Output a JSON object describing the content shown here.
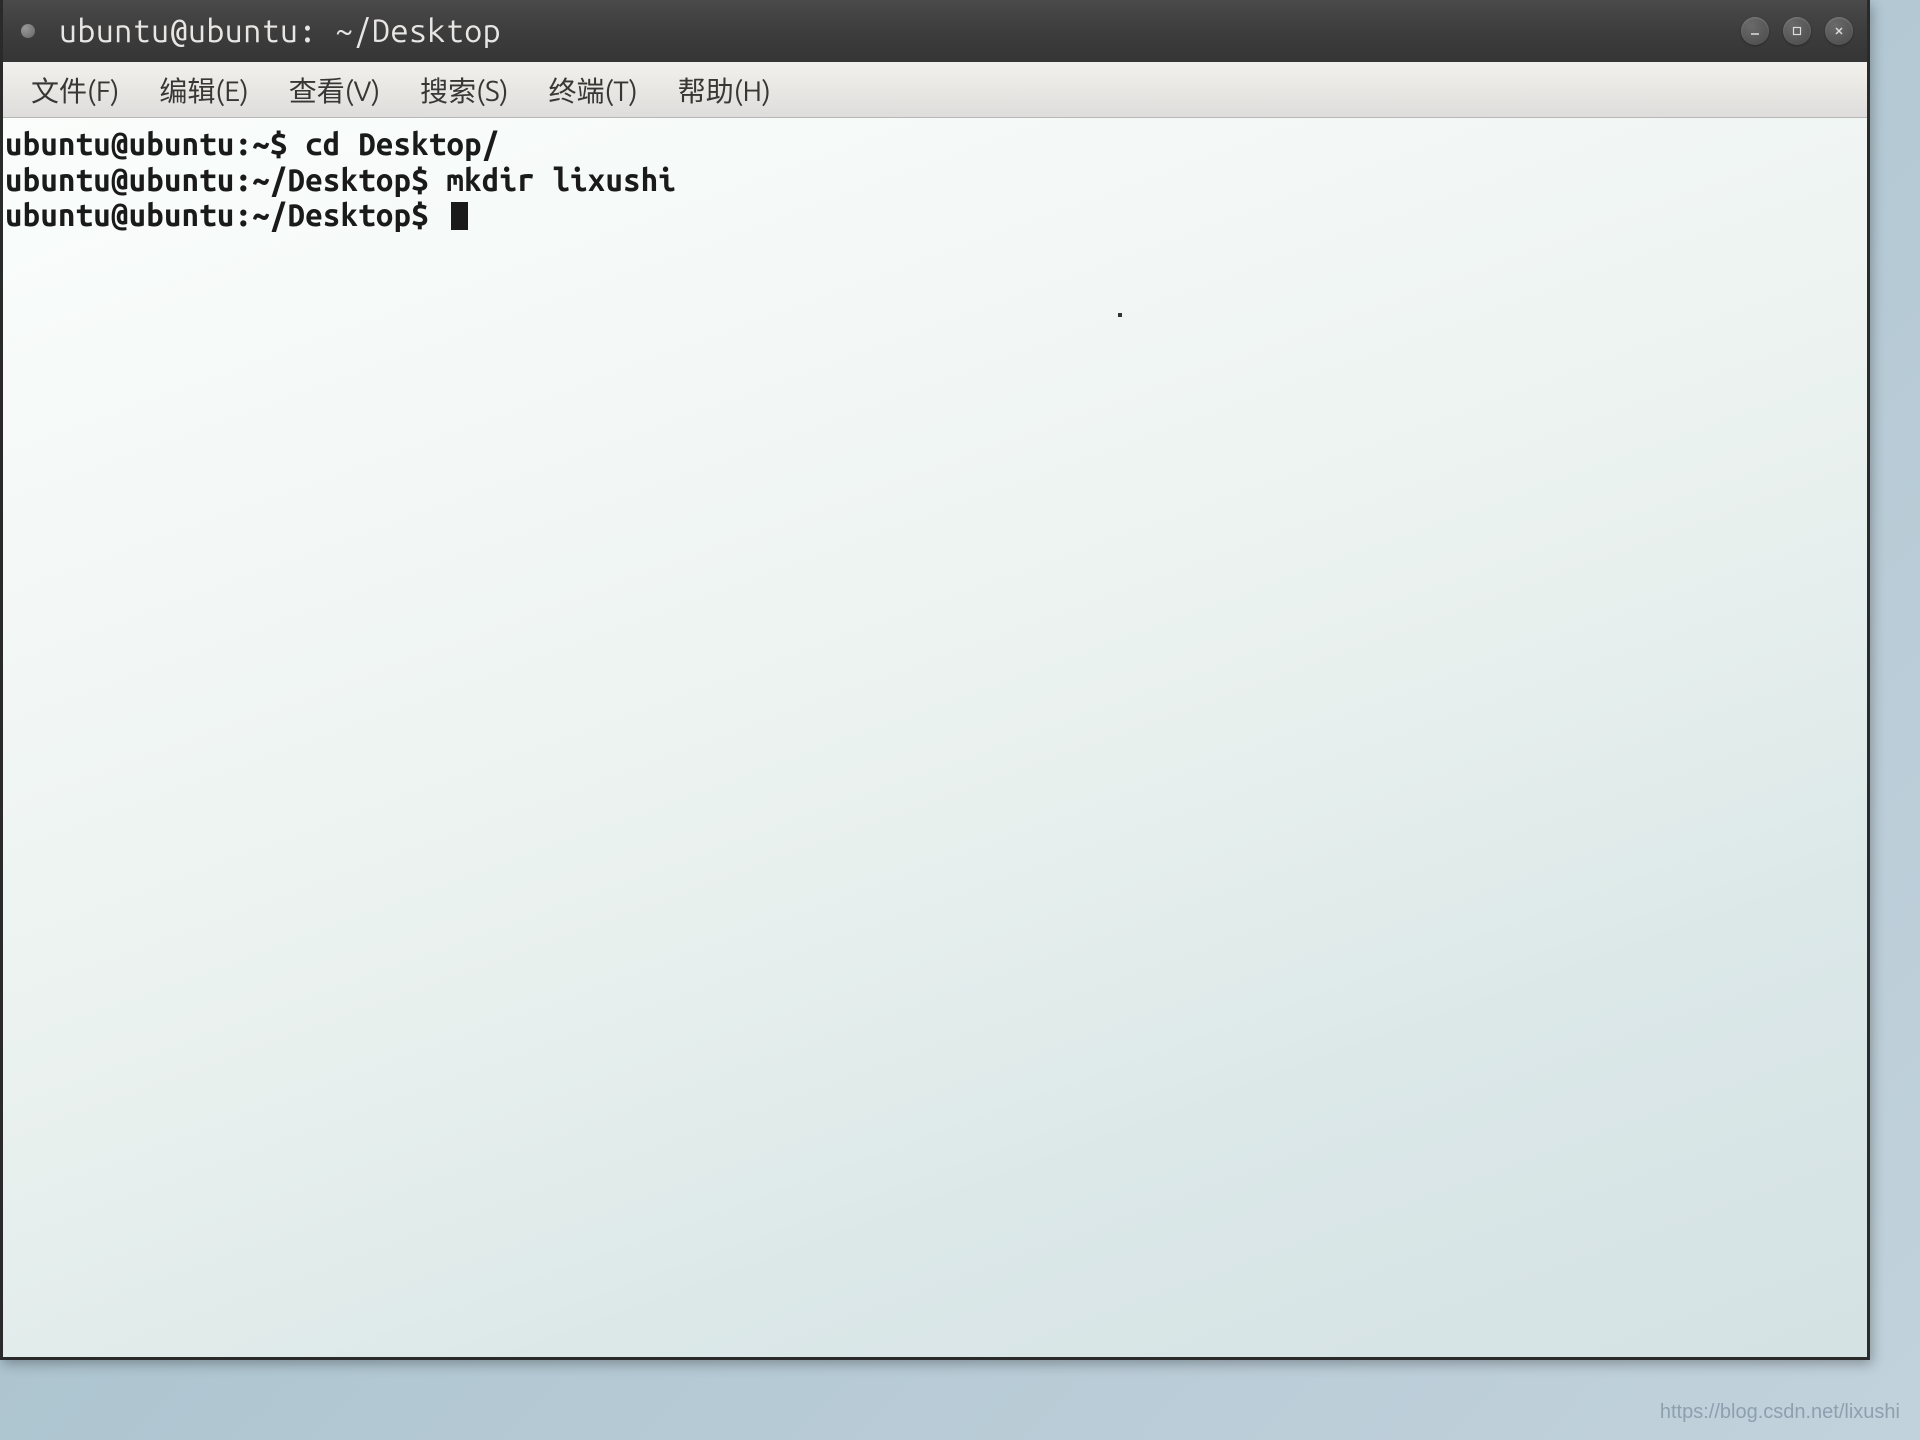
{
  "window": {
    "title": "ubuntu@ubuntu: ~/Desktop"
  },
  "menu": {
    "file": "文件(F)",
    "edit": "编辑(E)",
    "view": "查看(V)",
    "search": "搜索(S)",
    "terminal": "终端(T)",
    "help": "帮助(H)"
  },
  "terminal": {
    "line1": "ubuntu@ubuntu:~$ cd Desktop/",
    "line2": "ubuntu@ubuntu:~/Desktop$ mkdir lixushi",
    "line3": "ubuntu@ubuntu:~/Desktop$ "
  },
  "watermark": "https://blog.csdn.net/lixushi"
}
